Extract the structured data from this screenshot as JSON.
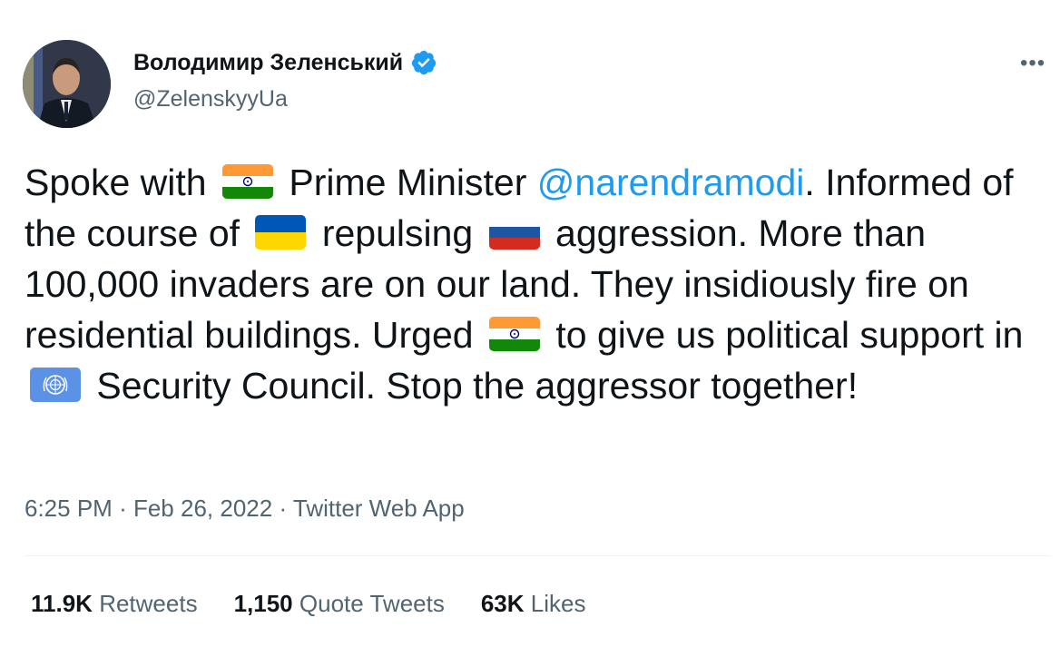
{
  "author": {
    "display_name": "Володимир Зеленський",
    "handle": "@ZelenskyyUa",
    "verified": true
  },
  "menu": {
    "more_icon": "more-horizontal-icon",
    "more_label": "•••"
  },
  "tweet": {
    "t1": "Spoke with",
    "t2": "Prime Minister",
    "mention": "@narendramodi",
    "t3": ".",
    "t4": "Informed of the course of",
    "t5": "repulsing",
    "t6": "aggression.",
    "t7": "More than 100,000 invaders are on our land. They insidiously fire on residential buildings. Urged",
    "t8": "to give us political support in",
    "t9": "Security Council. Stop the aggressor together!",
    "flags": [
      "flag-india",
      "flag-ukraine",
      "flag-russia",
      "flag-india",
      "flag-un"
    ]
  },
  "meta": {
    "time": "6:25 PM",
    "date": "Feb 26, 2022",
    "sep": "·",
    "source": "Twitter Web App"
  },
  "stats": {
    "retweets_count": "11.9K",
    "retweets_label": "Retweets",
    "quotes_count": "1,150",
    "quotes_label": "Quote Tweets",
    "likes_count": "63K",
    "likes_label": "Likes"
  },
  "colors": {
    "accent": "#1d9bf0",
    "text": "#0f1419",
    "secondary": "#536471",
    "divider": "#eff3f4"
  }
}
